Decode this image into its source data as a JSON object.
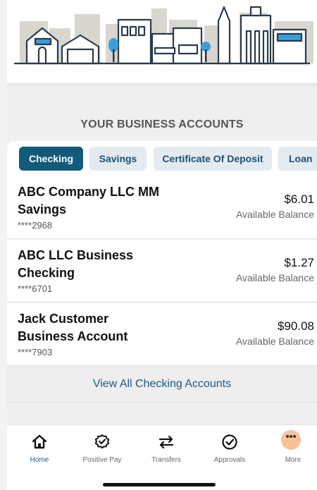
{
  "section_title": "YOUR BUSINESS ACCOUNTS",
  "tabs": [
    {
      "label": "Checking",
      "active": true
    },
    {
      "label": "Savings",
      "active": false
    },
    {
      "label": "Certificate Of Deposit",
      "active": false
    },
    {
      "label": "Loan",
      "active": false
    }
  ],
  "accounts": [
    {
      "name": "ABC Company LLC MM Savings",
      "mask": "****2968",
      "amount": "$6.01",
      "balance_label": "Available Balance"
    },
    {
      "name": "ABC LLC Business Checking",
      "mask": "****6701",
      "amount": "$1.27",
      "balance_label": "Available Balance"
    },
    {
      "name": "Jack Customer Business Account",
      "mask": "****7903",
      "amount": "$90.08",
      "balance_label": "Available Balance"
    }
  ],
  "view_all_label": "View All Checking Accounts",
  "nav": [
    {
      "label": "Home",
      "icon": "home-icon",
      "active": true
    },
    {
      "label": "Positive Pay",
      "icon": "badge-check-icon",
      "active": false
    },
    {
      "label": "Transfers",
      "icon": "transfer-arrows-icon",
      "active": false
    },
    {
      "label": "Approvals",
      "icon": "check-circle-icon",
      "active": false
    },
    {
      "label": "More",
      "icon": "more-dots-icon",
      "active": false
    }
  ],
  "colors": {
    "primary": "#135a7a",
    "tab_inactive_bg": "#e3ebf1",
    "link": "#1d5a86",
    "hero_accent": "#3a9fd8",
    "touch_indicator": "#f7b686"
  }
}
